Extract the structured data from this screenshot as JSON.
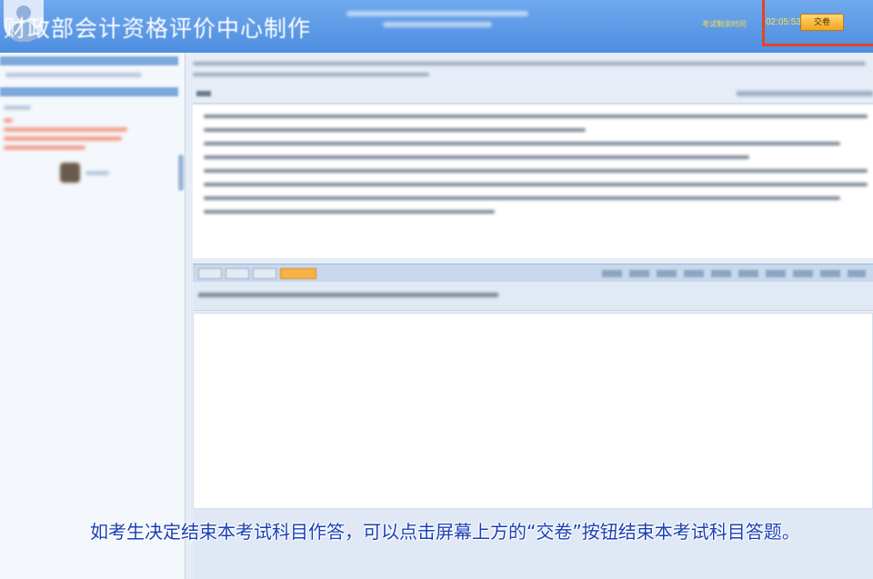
{
  "header": {
    "maker_text": "财政部会计资格评价中心制作",
    "timer_label": "考试剩余时间:",
    "timer_value": "02:05:53",
    "submit_label": "交卷"
  },
  "colors": {
    "header_blue": "#5b9be6",
    "highlight_red": "#e2451f",
    "submit_orange": "#f3a621",
    "subtitle_blue": "#1a3fb5"
  },
  "icons": {
    "avatar": "user-avatar-icon"
  },
  "subtitle": {
    "text": "如考生决定结束本考试科目作答，可以点击屏幕上方的“交卷”按钮结束本考试科目答题。"
  }
}
